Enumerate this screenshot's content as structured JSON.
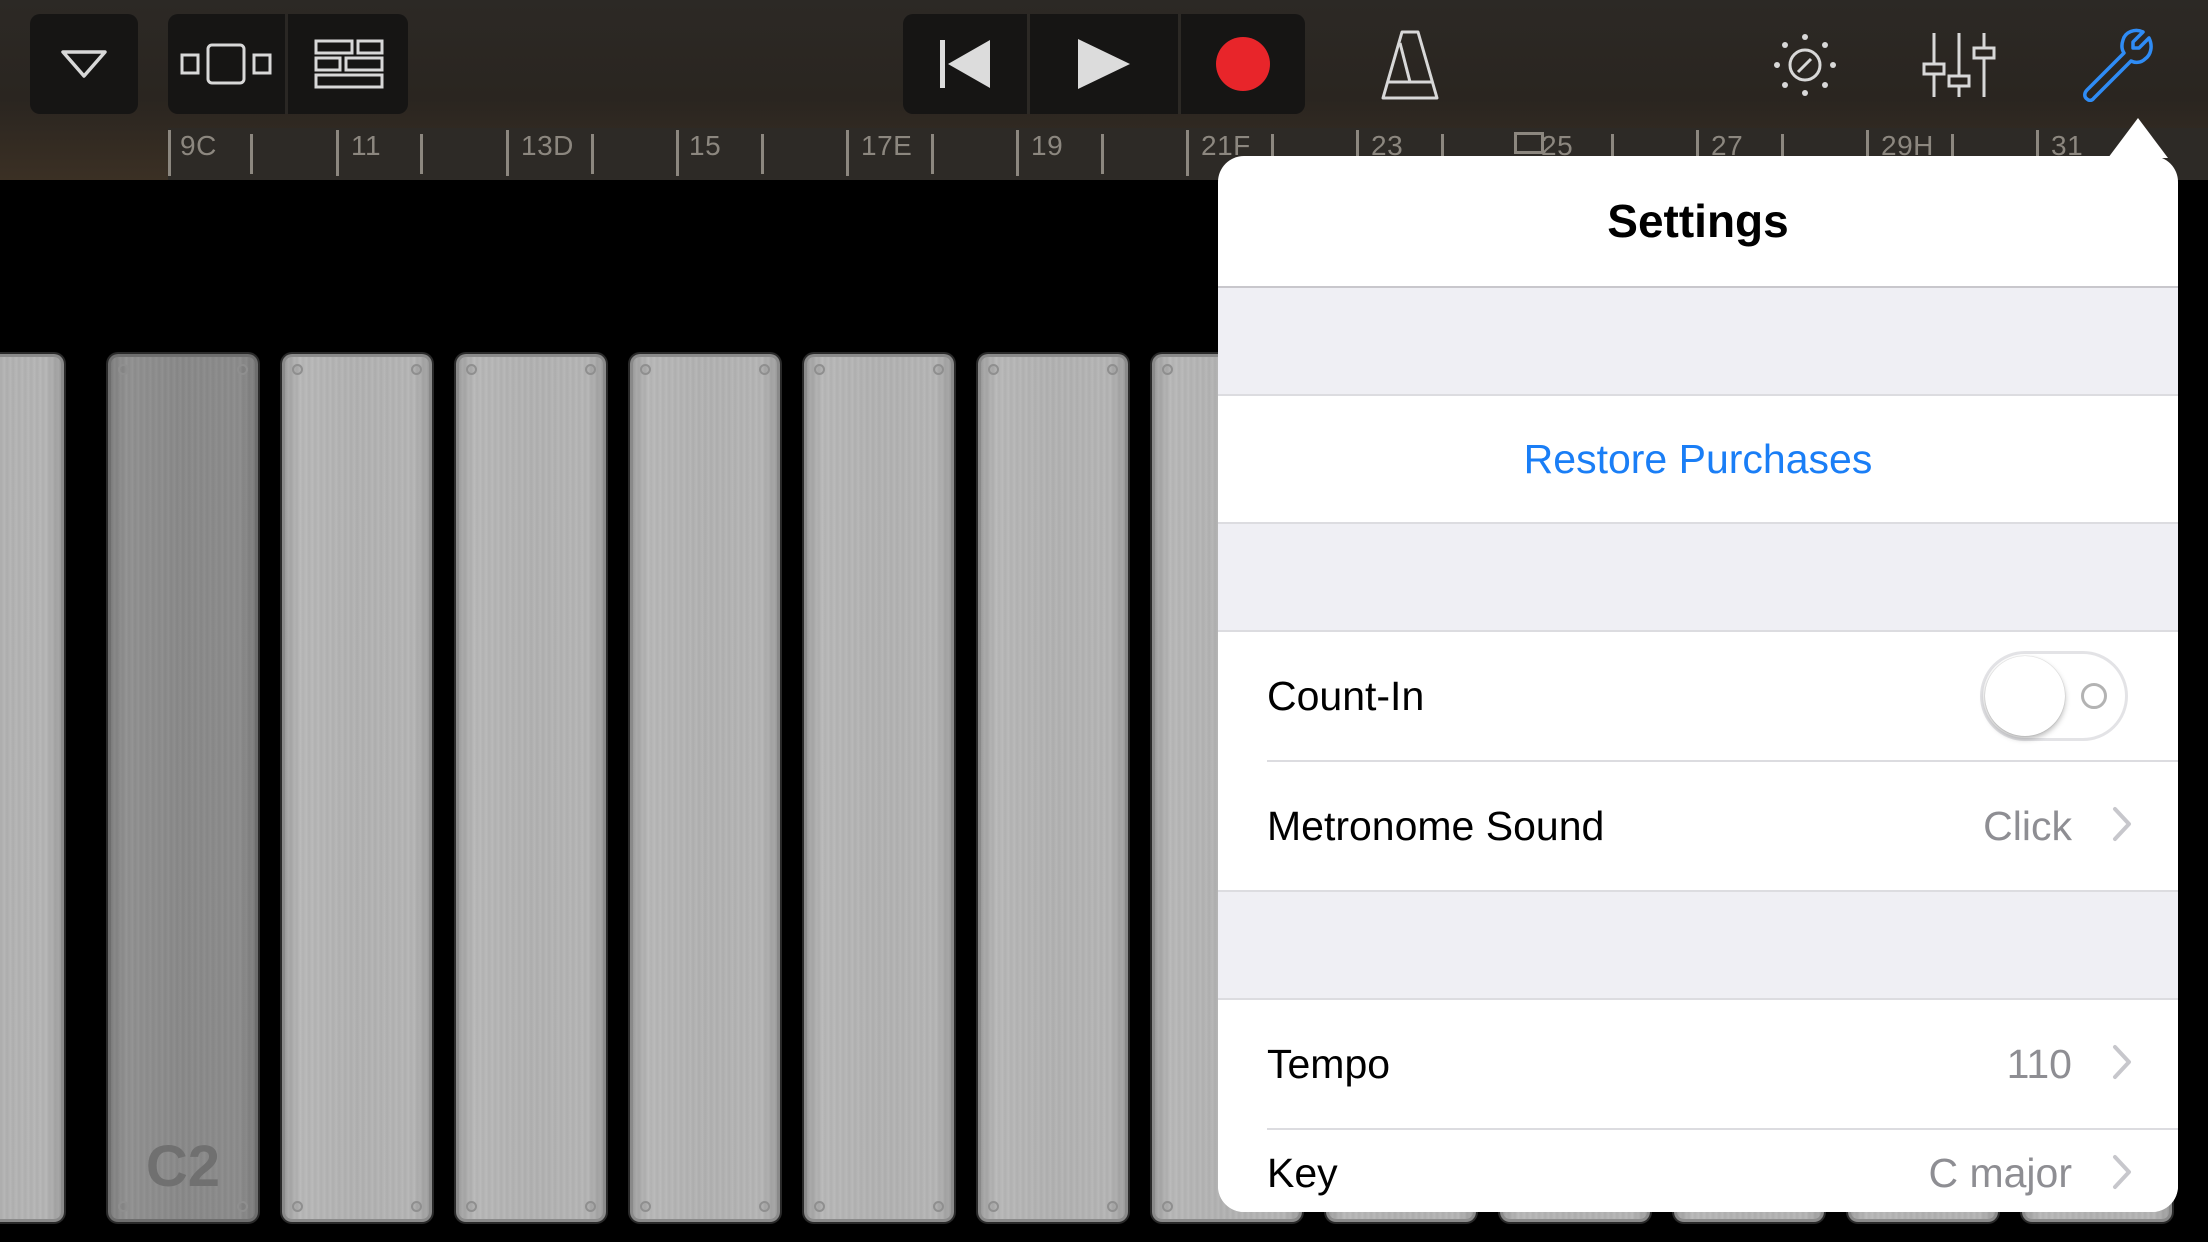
{
  "toolbar": {
    "browser_icon": "chevron-down-icon",
    "view_icons": [
      "track-view-icon",
      "tracks-list-icon"
    ],
    "transport": [
      "go-to-beginning-icon",
      "play-icon",
      "record-icon"
    ],
    "right_icons": [
      "metronome-icon",
      "brightness-dial-icon",
      "mixer-sliders-icon",
      "wrench-icon"
    ],
    "record_color": "#e8252a",
    "accent_color": "#1a7ef6"
  },
  "ruler": {
    "labels": [
      "9C",
      "11",
      "13D",
      "15",
      "17E",
      "19",
      "21F",
      "23",
      "25",
      "27",
      "29H",
      "31"
    ]
  },
  "keyboard": {
    "note_label": "C2"
  },
  "settings": {
    "title": "Settings",
    "restore_label": "Restore Purchases",
    "count_in": {
      "label": "Count-In",
      "on": false
    },
    "metronome_sound": {
      "label": "Metronome Sound",
      "value": "Click"
    },
    "tempo": {
      "label": "Tempo",
      "value": "110"
    },
    "key": {
      "label": "Key",
      "value": "C major"
    }
  }
}
